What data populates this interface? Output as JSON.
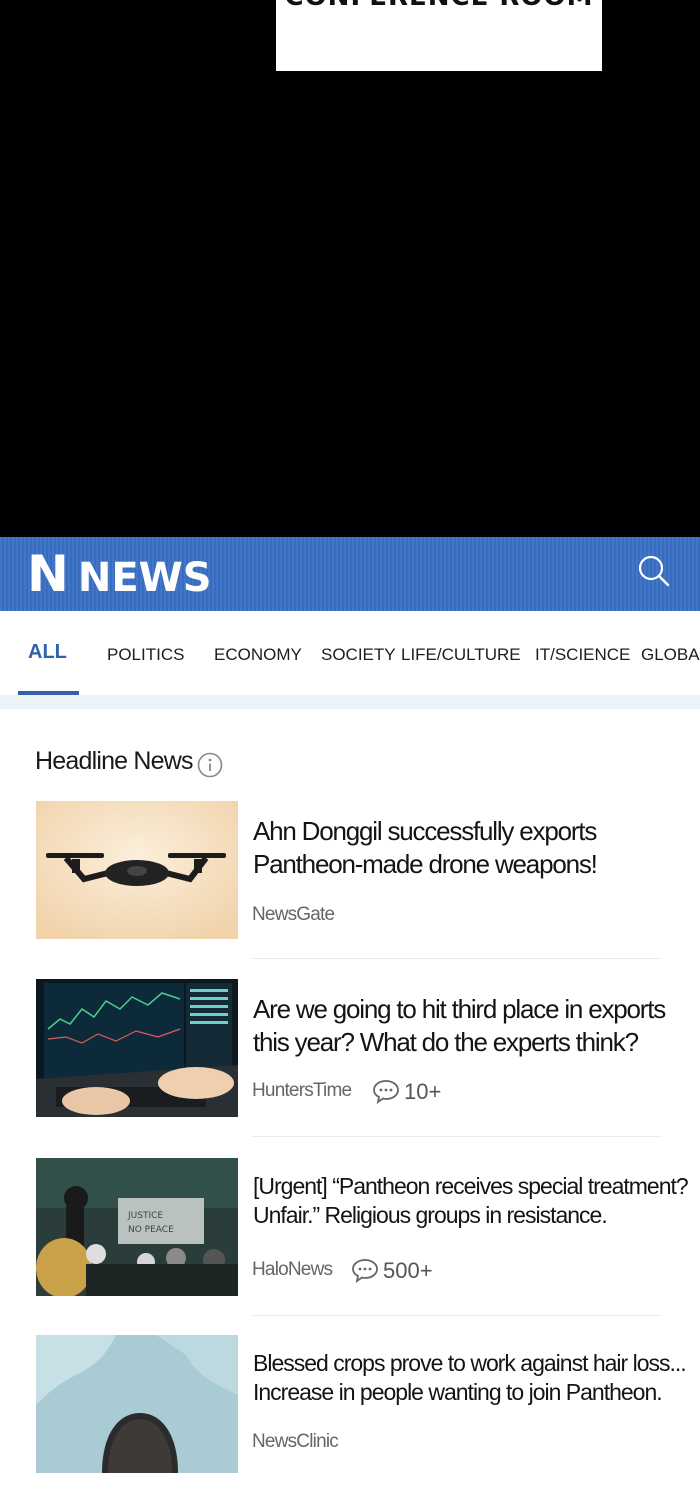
{
  "background_sign": {
    "text": "CONFERENCE ROOM"
  },
  "app": {
    "logo": {
      "mark": "N",
      "word": "NEWS"
    },
    "brand_color": "#3a6fc4",
    "accent_color": "#2e62ad",
    "search_icon": "search-icon"
  },
  "tabs": [
    {
      "label": "ALL",
      "active": true
    },
    {
      "label": "POLITICS"
    },
    {
      "label": "ECONOMY"
    },
    {
      "label": "SOCIETY"
    },
    {
      "label": "LIFE/CULTURE"
    },
    {
      "label": "IT/SCIENCE"
    },
    {
      "label": "GLOBAL"
    }
  ],
  "section": {
    "title": "Headline News",
    "icon": "info-icon"
  },
  "articles": [
    {
      "line1": "Ahn Donggil successfully exports",
      "line2": "Pantheon-made drone weapons!",
      "source": "NewsGate",
      "comments": ""
    },
    {
      "line1": "Are we going to hit third place in exports",
      "line2": "this year? What do the experts think?",
      "source": "HuntersTime",
      "comments": "10+"
    },
    {
      "line1": "[Urgent] “Pantheon receives special treatment?",
      "line2": "Unfair.” Religious groups in resistance.",
      "source": "HaloNews",
      "comments": "500+"
    },
    {
      "line1": "Blessed crops prove to work against hair loss...",
      "line2": "Increase in people wanting to join Pantheon.",
      "source": "NewsClinic",
      "comments": ""
    }
  ]
}
